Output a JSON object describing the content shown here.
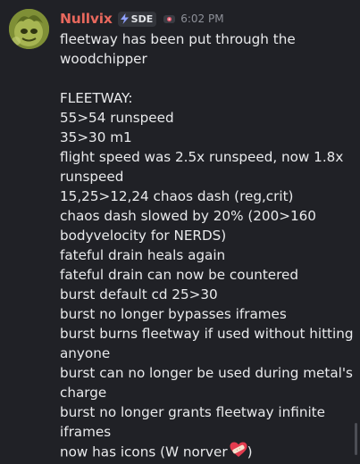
{
  "author": {
    "name": "Nullvix",
    "tag": "SDE",
    "timestamp": "6:02 PM",
    "avatar": "avatar-picture",
    "name_color": "#e8685d"
  },
  "message": {
    "lines": [
      "fleetway has been put through the",
      "woodchipper",
      "",
      "FLEETWAY:",
      "55>54 runspeed",
      "35>30 m1",
      "flight speed was 2.5x runspeed, now 1.8x",
      "runspeed",
      "15,25>12,24 chaos dash (reg,crit)",
      "chaos dash slowed by 20% (200>160",
      "bodyvelocity for NERDS)",
      "fateful drain heals again",
      "fateful drain can now be countered",
      "burst default cd 25>30",
      "burst no longer bypasses iframes",
      "burst burns fleetway if used without hitting",
      "anyone",
      "burst can no longer be used during metal's",
      "charge",
      "burst no longer grants fleetway infinite",
      "iframes",
      "now has icons (W norver",
      ")"
    ],
    "emoji": "heart-with-bandage-icon"
  }
}
